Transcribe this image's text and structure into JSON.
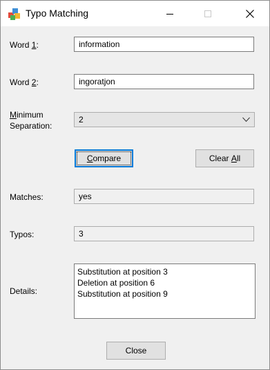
{
  "window": {
    "title": "Typo Matching"
  },
  "form": {
    "word1": {
      "label_pre": "Word ",
      "label_accel": "1",
      "label_post": ":",
      "value": "information"
    },
    "word2": {
      "label_pre": "Word ",
      "label_accel": "2",
      "label_post": ":",
      "value": "ingoratjon"
    },
    "min_sep": {
      "label_accel": "M",
      "label_line1_rest": "inimum",
      "label_line2": "Separation:",
      "value": "2"
    },
    "compare_accel": "C",
    "compare_rest": "ompare",
    "clear_pre": "Clear ",
    "clear_accel": "A",
    "clear_rest": "ll",
    "matches": {
      "label": "Matches:",
      "value": "yes"
    },
    "typos": {
      "label": "Typos:",
      "value": "3"
    },
    "details": {
      "label": "Details:",
      "lines": [
        "Substitution at position 3",
        "Deletion at position 6",
        "Substitution at position 9"
      ]
    },
    "close_label": "Close"
  },
  "icons": {
    "app": "app-icon",
    "minimize": "minimize-icon",
    "maximize": "maximize-icon",
    "close": "close-icon",
    "dropdown": "chevron-down-icon"
  }
}
